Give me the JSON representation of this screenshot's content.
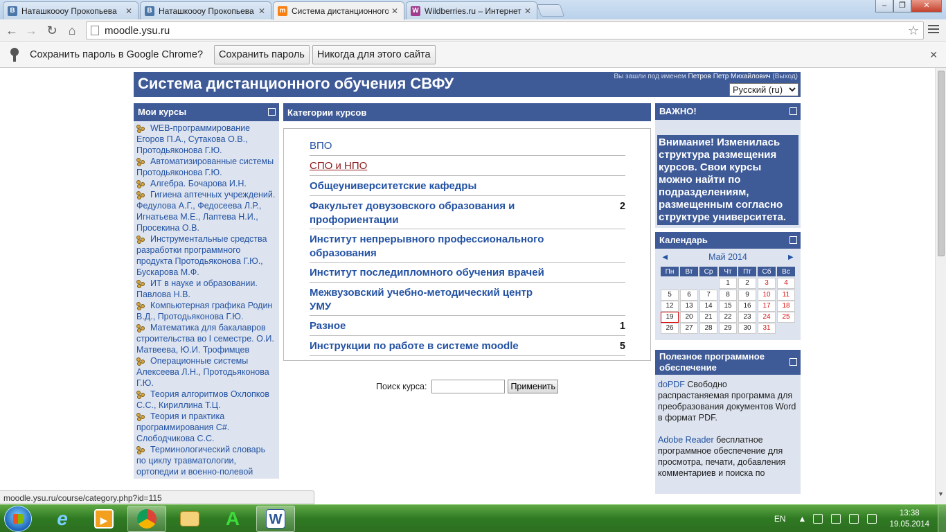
{
  "browser": {
    "tabs": [
      {
        "label": "Наташкоооу Прокопьева",
        "favicon": "vk-icon",
        "color": "#4a76a8",
        "glyph": "B"
      },
      {
        "label": "Наташкоооу Прокопьева",
        "favicon": "vk-icon",
        "color": "#4a76a8",
        "glyph": "B"
      },
      {
        "label": "Система дистанционного",
        "favicon": "moodle-icon",
        "color": "#f98012",
        "glyph": "m"
      },
      {
        "label": "Wildberries.ru – Интернет",
        "favicon": "wildberries-icon",
        "color": "#a23a8d",
        "glyph": "W"
      }
    ],
    "url": "moodle.ysu.ru",
    "infobar": {
      "message": "Сохранить пароль в Google Chrome?",
      "save_button": "Сохранить пароль",
      "never_button": "Никогда для этого сайта"
    }
  },
  "header": {
    "title": "Система дистанционного обучения СВФУ",
    "login_prefix": "Вы зашли под именем",
    "user_name": "Петров Петр Михайлович",
    "logout": "(Выход)",
    "language": "Русский (ru)"
  },
  "my_courses": {
    "title": "Мои курсы",
    "items": [
      "WEB-программирование Егоров П.А., Сутакова О.В., Протодьяконова Г.Ю.",
      "Автоматизированные системы Протодьяконова Г.Ю.",
      "Алгебра. Бочарова И.Н.",
      "Гигиена аптечных учреждений. Федулова А.Г., Федосеева Л.Р., Игнатьева М.Е., Лаптева Н.И., Просекина О.В.",
      "Инструментальные средства разработки программного продукта Протодьяконова Г.Ю., Бускарова М.Ф.",
      "ИТ в науке и образовании. Павлова Н.В.",
      "Компьютерная графика Родин В.Д., Протодьяконова Г.Ю.",
      "Математика для бакалавров строительства во I семестре. О.И. Матвеева, Ю.И. Трофимцев",
      "Операционные системы Алексеева Л.Н., Протодьяконова Г.Ю.",
      "Теория алгоритмов Охлопков С.С., Кириллина Т.Ц.",
      "Теория и практика программирования C#. Слободчикова С.С.",
      "Терминологический словарь по циклу травматологии, ортопедии и военно-полевой"
    ]
  },
  "categories": {
    "title": "Категории курсов",
    "items": [
      {
        "name": "ВПО",
        "count": ""
      },
      {
        "name": "СПО и НПО",
        "count": ""
      },
      {
        "name": "Общеуниверситетские кафедры",
        "count": ""
      },
      {
        "name": "Факультет довузовского образования и профориентации",
        "count": "2"
      },
      {
        "name": "Институт непрерывного профессионального образования",
        "count": ""
      },
      {
        "name": "Институт последипломного обучения врачей",
        "count": ""
      },
      {
        "name": "Межвузовский учебно-методический центр УМУ",
        "count": ""
      },
      {
        "name": "Разное",
        "count": "1"
      },
      {
        "name": "Инструкции по работе в системе moodle",
        "count": "5"
      }
    ],
    "search_label": "Поиск курса:",
    "search_value": "",
    "search_button": "Применить"
  },
  "important": {
    "title": "ВАЖНО!",
    "text": "Внимание! Изменилась структура размещения курсов. Свои курсы можно найти по подразделениям, размещенным согласно структуре университета."
  },
  "calendar": {
    "title": "Календарь",
    "prev": "◄",
    "next": "►",
    "month": "Май 2014",
    "day_names": [
      "Пн",
      "Вт",
      "Ср",
      "Чт",
      "Пт",
      "Сб",
      "Вс"
    ],
    "weeks": [
      [
        "",
        "",
        "",
        "1",
        "2",
        "3",
        "4"
      ],
      [
        "5",
        "6",
        "7",
        "8",
        "9",
        "10",
        "11"
      ],
      [
        "12",
        "13",
        "14",
        "15",
        "16",
        "17",
        "18"
      ],
      [
        "19",
        "20",
        "21",
        "22",
        "23",
        "24",
        "25"
      ],
      [
        "26",
        "27",
        "28",
        "29",
        "30",
        "31",
        ""
      ]
    ],
    "today": "19",
    "weekend_color": "#dd1111"
  },
  "software": {
    "title": "Полезное программное обеспечение",
    "items": [
      {
        "link": "doPDF",
        "text": "Свободно распрастаняемая программа для преобразования документов Word в формат PDF."
      },
      {
        "link": "Adobe Reader",
        "text": "бесплатное программное обеспечение для просмотра, печати, добавления комментариев и поиска по"
      }
    ]
  },
  "status_url": "moodle.ysu.ru/course/category.php?id=115",
  "taskbar": {
    "language": "EN",
    "time": "13:38",
    "date": "19.05.2014"
  },
  "colors": {
    "moodle_blue": "#3e5a97",
    "link_blue": "#2352a3",
    "visited_red": "#8b1a1a",
    "block_bg": "#dde4ef"
  }
}
